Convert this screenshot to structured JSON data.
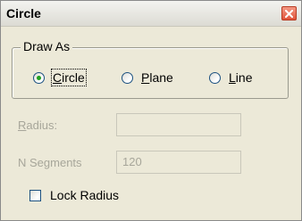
{
  "window": {
    "title": "Circle",
    "close_icon": "close-x-icon"
  },
  "draw_as": {
    "legend": "Draw As",
    "options": [
      {
        "label_pre": "",
        "label_ul": "C",
        "label_post": "ircle",
        "selected": true
      },
      {
        "label_pre": "",
        "label_ul": "P",
        "label_post": "lane",
        "selected": false
      },
      {
        "label_pre": "",
        "label_ul": "L",
        "label_post": "ine",
        "selected": false
      }
    ]
  },
  "radius": {
    "label_ul": "R",
    "label_post": "adius:",
    "value": "",
    "enabled": false
  },
  "segments": {
    "label": "N Segments",
    "value": "120",
    "enabled": false
  },
  "lock_radius": {
    "label": "Lock Radius",
    "checked": false
  },
  "colors": {
    "dialog_bg": "#ece9d8",
    "radio_selected": "#21a121",
    "close_button": "#e0533a",
    "disabled_text": "#a7a69a"
  }
}
